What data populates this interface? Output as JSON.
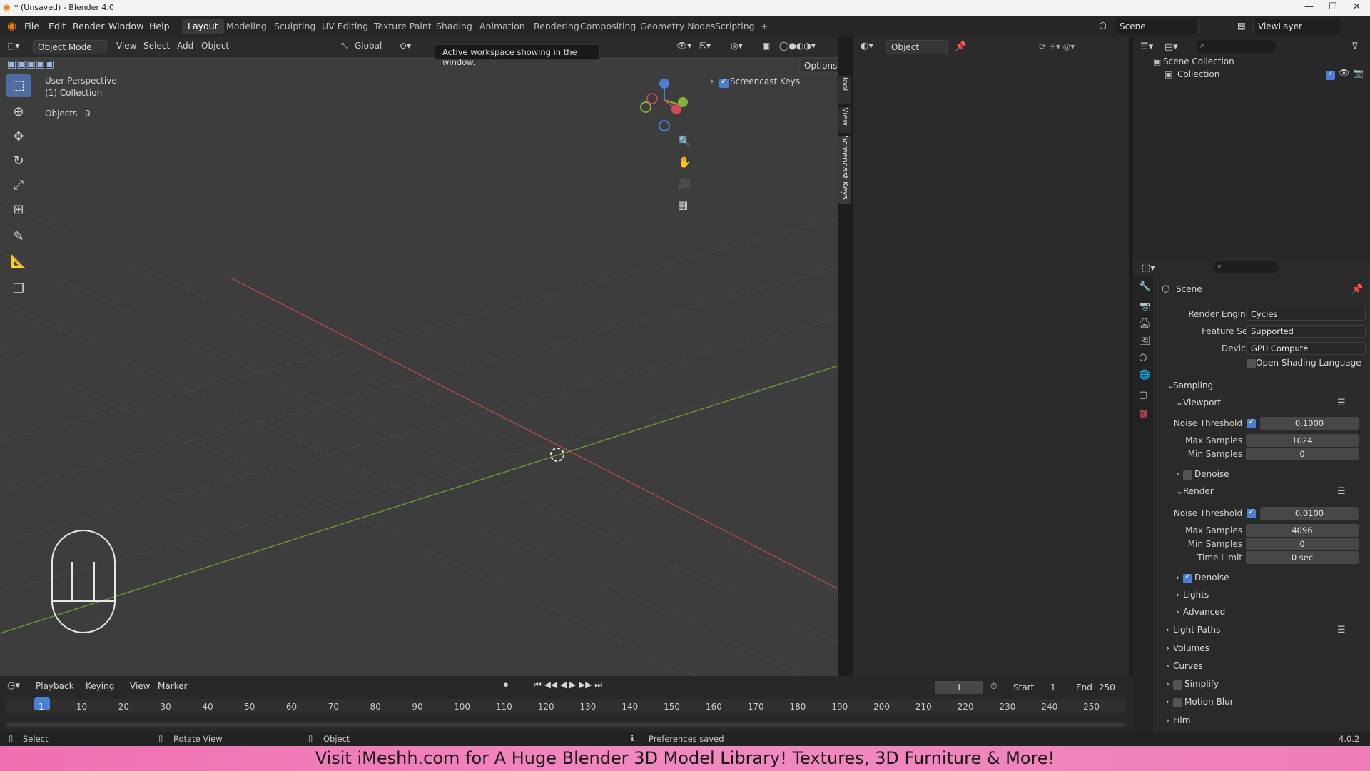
{
  "titlebar": {
    "title": "* (Unsaved) - Blender 4.0",
    "min": "—",
    "max": "☐",
    "close": "✕"
  },
  "menu": {
    "file": "File",
    "edit": "Edit",
    "render": "Render",
    "window": "Window",
    "help": "Help"
  },
  "workspaces": [
    "Layout",
    "Modeling",
    "Sculpting",
    "UV Editing",
    "Texture Paint",
    "Shading",
    "Animation",
    "Rendering",
    "Compositing",
    "Geometry Nodes",
    "Scripting",
    "+"
  ],
  "scene_field": "Scene",
  "viewlayer_field": "ViewLayer",
  "tooltip": "Active workspace showing in the window.",
  "viewport": {
    "mode": "Object Mode",
    "menus": [
      "View",
      "Select",
      "Add",
      "Object"
    ],
    "orientation": "Global",
    "options": "Options",
    "overlay_perspective": "User Perspective",
    "overlay_collection": "(1) Collection",
    "objects_label": "Objects",
    "objects_count": "0",
    "screencast_label": "Screencast Keys",
    "side_tabs": [
      "Tool",
      "View",
      "Screencast Keys"
    ]
  },
  "midpanel": {
    "object_dropdown": "Object"
  },
  "outliner": {
    "scene_collection": "Scene Collection",
    "collection": "Collection"
  },
  "props": {
    "scene": "Scene",
    "render_engine_label": "Render Engine",
    "render_engine": "Cycles",
    "feature_set_label": "Feature Set",
    "feature_set": "Supported",
    "device_label": "Device",
    "device": "GPU Compute",
    "osl_label": "Open Shading Language",
    "sampling": "Sampling",
    "viewport": "Viewport",
    "noise_threshold_label": "Noise Threshold",
    "vp_noise": "0.1000",
    "max_samples_label": "Max Samples",
    "vp_max": "1024",
    "min_samples_label": "Min Samples",
    "vp_min": "0",
    "denoise": "Denoise",
    "render": "Render",
    "r_noise": "0.0100",
    "r_max": "4096",
    "r_min": "0",
    "time_limit_label": "Time Limit",
    "r_time": "0 sec",
    "lights": "Lights",
    "advanced": "Advanced",
    "light_paths": "Light Paths",
    "volumes": "Volumes",
    "curves": "Curves",
    "simplify": "Simplify",
    "motion_blur": "Motion Blur",
    "film": "Film"
  },
  "timeline": {
    "menus": [
      "Playback",
      "Keying",
      "View",
      "Marker"
    ],
    "current_frame": "1",
    "start_label": "Start",
    "start": "1",
    "end_label": "End",
    "end": "250",
    "ticks": [
      "1",
      "10",
      "20",
      "30",
      "40",
      "50",
      "60",
      "70",
      "80",
      "90",
      "100",
      "110",
      "120",
      "130",
      "140",
      "150",
      "160",
      "170",
      "180",
      "190",
      "200",
      "210",
      "220",
      "230",
      "240",
      "250"
    ]
  },
  "status": {
    "select": "Select",
    "rotate": "Rotate View",
    "object": "Object",
    "message": "Preferences saved",
    "version": "4.0.2"
  },
  "banner": "Visit iMeshh.com for A Huge Blender 3D Model Library! Textures, 3D Furniture & More!"
}
